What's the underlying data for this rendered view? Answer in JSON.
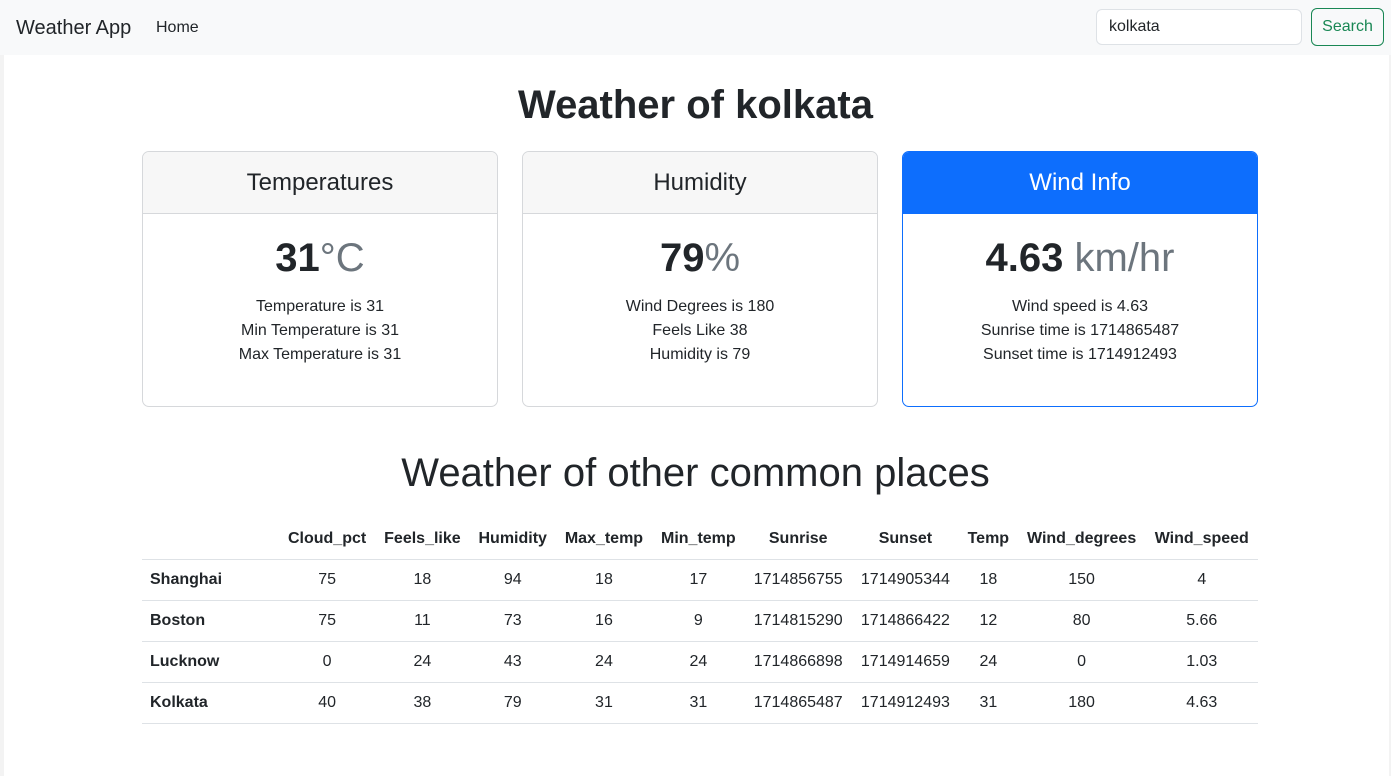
{
  "navbar": {
    "brand": "Weather App",
    "home_label": "Home",
    "search_value": "kolkata",
    "search_button": "Search"
  },
  "main": {
    "title": "Weather of kolkata",
    "cards": {
      "temperatures": {
        "header": "Temperatures",
        "value": "31",
        "unit": "°C",
        "lines": [
          "Temperature is 31",
          "Min Temperature is 31",
          "Max Temperature is 31"
        ]
      },
      "humidity": {
        "header": "Humidity",
        "value": "79",
        "unit": "%",
        "lines": [
          "Wind Degrees is 180",
          "Feels Like 38",
          "Humidity is 79"
        ]
      },
      "wind": {
        "header": "Wind Info",
        "value": "4.63",
        "unit": "km/hr",
        "lines": [
          "Wind speed is 4.63",
          "Sunrise time is 1714865487",
          "Sunset time is 1714912493"
        ]
      }
    }
  },
  "other_places": {
    "title": "Weather of other common places",
    "columns": [
      "Cloud_pct",
      "Feels_like",
      "Humidity",
      "Max_temp",
      "Min_temp",
      "Sunrise",
      "Sunset",
      "Temp",
      "Wind_degrees",
      "Wind_speed"
    ],
    "rows": [
      {
        "city": "Shanghai",
        "cells": [
          "75",
          "18",
          "94",
          "18",
          "17",
          "1714856755",
          "1714905344",
          "18",
          "150",
          "4"
        ]
      },
      {
        "city": "Boston",
        "cells": [
          "75",
          "11",
          "73",
          "16",
          "9",
          "1714815290",
          "1714866422",
          "12",
          "80",
          "5.66"
        ]
      },
      {
        "city": "Lucknow",
        "cells": [
          "0",
          "24",
          "43",
          "24",
          "24",
          "1714866898",
          "1714914659",
          "24",
          "0",
          "1.03"
        ]
      },
      {
        "city": "Kolkata",
        "cells": [
          "40",
          "38",
          "79",
          "31",
          "31",
          "1714865487",
          "1714912493",
          "31",
          "180",
          "4.63"
        ]
      }
    ]
  },
  "colors": {
    "primary": "#0d6efd",
    "success": "#198754",
    "navbar_bg": "#f8f9fa",
    "muted": "#6c757d"
  }
}
